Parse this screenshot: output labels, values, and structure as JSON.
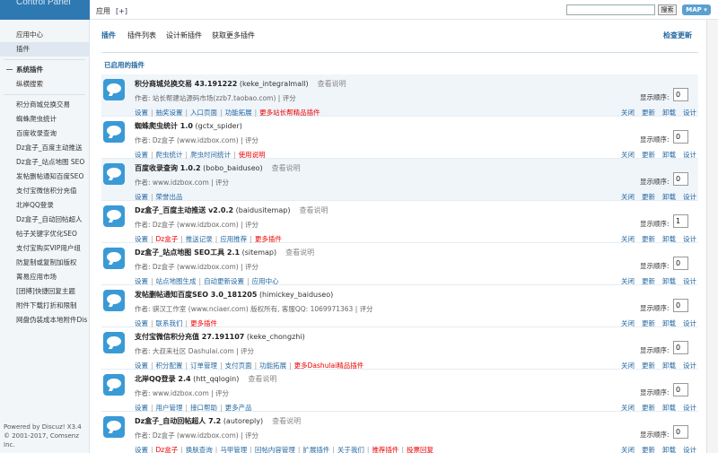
{
  "brand": "Control Panel",
  "header": {
    "crumb": "应用",
    "add": "[+]",
    "search_btn": "搜索",
    "map_btn": "MAP ▾"
  },
  "sidebar": {
    "items": [
      {
        "label": "应用中心",
        "type": "item"
      },
      {
        "label": "插件",
        "type": "item",
        "active": true
      },
      {
        "label": "系统插件",
        "type": "group"
      },
      {
        "label": "纵横搜索",
        "type": "item"
      },
      {
        "label": "积分商城兑换交易",
        "type": "item"
      },
      {
        "label": "蜘蛛爬虫统计",
        "type": "item"
      },
      {
        "label": "百度收录查询",
        "type": "item"
      },
      {
        "label": "Dz盒子_百度主动推送",
        "type": "item"
      },
      {
        "label": "Dz盒子_站点地图 SEO",
        "type": "item"
      },
      {
        "label": "发帖删帖通知百度SEO",
        "type": "item"
      },
      {
        "label": "支付宝微信积分充值",
        "type": "item"
      },
      {
        "label": "北岸QQ登录",
        "type": "item"
      },
      {
        "label": "Dz盒子_自动回帖超人",
        "type": "item"
      },
      {
        "label": "帖子关键字优化SEO",
        "type": "item"
      },
      {
        "label": "支付宝购买VIP用户组",
        "type": "item"
      },
      {
        "label": "防复制或复制加版权",
        "type": "item"
      },
      {
        "label": "菁易应用市场",
        "type": "item"
      },
      {
        "label": "[团搏]快捷回复主题",
        "type": "item"
      },
      {
        "label": "附件下载打折和限制",
        "type": "item"
      },
      {
        "label": "网盘伪装成本地附件Dis",
        "type": "item"
      }
    ],
    "footer_line1": "Powered by Discuz! X3.4",
    "footer_line2": "© 2001-2017, Comsenz Inc."
  },
  "subnav": {
    "current": "插件",
    "tabs": [
      "插件列表",
      "设计新插件",
      "获取更多插件"
    ],
    "check_update": "检查更新"
  },
  "list": {
    "heading": "已启用的插件",
    "order_label": "显示顺序:",
    "ops": [
      "关闭",
      "更新",
      "卸载",
      "设计"
    ],
    "plugins": [
      {
        "name": "积分商城兑换交易 43.191222",
        "id": "(keke_integralmall)",
        "readme": "查看说明",
        "author": "作者: 站长帮建站源码市场(zzb7.taobao.com)",
        "score": "评分",
        "order": "0",
        "shade": true,
        "links": [
          {
            "t": "设置"
          },
          {
            "t": "抽奖设置"
          },
          {
            "t": "入口页面"
          },
          {
            "t": "功能拓展"
          },
          {
            "t": "更多站长帮精品插件",
            "red": true
          }
        ]
      },
      {
        "name": "蜘蛛爬虫统计 1.0",
        "id": "(gctx_spider)",
        "readme": "",
        "author": "作者: Dz盒子 (www.idzbox.com)",
        "score": "评分",
        "order": "0",
        "shade": false,
        "links": [
          {
            "t": "设置"
          },
          {
            "t": "爬虫统计"
          },
          {
            "t": "爬虫时间统计"
          },
          {
            "t": "使用说明",
            "red": true
          }
        ]
      },
      {
        "name": "百度收录查询 1.0.2",
        "id": "(bobo_baiduseo)",
        "readme": "查看说明",
        "author": "作者: www.idzbox.com",
        "score": "评分",
        "order": "0",
        "shade": true,
        "links": [
          {
            "t": "设置"
          },
          {
            "t": "荣誉出品"
          }
        ]
      },
      {
        "name": "Dz盒子_百度主动推送 v2.0.2",
        "id": "(baidusitemap)",
        "readme": "查看说明",
        "author": "作者: Dz盒子 (www.idzbox.com)",
        "score": "评分",
        "order": "1",
        "shade": false,
        "links": [
          {
            "t": "设置"
          },
          {
            "t": "Dz盒子",
            "red": true
          },
          {
            "t": "推送记录"
          },
          {
            "t": "应用推荐"
          },
          {
            "t": "更多插件",
            "red": true
          }
        ]
      },
      {
        "name": "Dz盒子_站点地图 SEO工具 2.1",
        "id": "(sitemap)",
        "readme": "查看说明",
        "author": "作者: Dz盒子 (www.idzbox.com)",
        "score": "评分",
        "order": "0",
        "shade": false,
        "links": [
          {
            "t": "设置"
          },
          {
            "t": "站点地图生成"
          },
          {
            "t": "自动更新设置"
          },
          {
            "t": "应用中心"
          }
        ]
      },
      {
        "name": "发帖删帖通知百度SEO 3.0_181205",
        "id": "(himickey_baiduseo)",
        "readme": "",
        "author": "作者: 骐汉工作室 (www.nciaer.com) 版权所有, 客服QQ: 1069971363",
        "score": "评分",
        "order": "0",
        "shade": false,
        "links": [
          {
            "t": "设置"
          },
          {
            "t": "联系我们"
          },
          {
            "t": "更多插件",
            "red": true
          }
        ]
      },
      {
        "name": "支付宝微信积分充值 27.191107",
        "id": "(keke_chongzhi)",
        "readme": "",
        "author": "作者: 大叔来社区 Dashulai.com",
        "score": "评分",
        "order": "0",
        "shade": false,
        "links": [
          {
            "t": "设置"
          },
          {
            "t": "积分配置"
          },
          {
            "t": "订单管理"
          },
          {
            "t": "支付页面"
          },
          {
            "t": "功能拓展"
          },
          {
            "t": "更多Dashulai精品插件",
            "red": true
          }
        ]
      },
      {
        "name": "北岸QQ登录 2.4",
        "id": "(htt_qqlogin)",
        "readme": "查看说明",
        "author": "作者: www.idzbox.com",
        "score": "评分",
        "order": "0",
        "shade": false,
        "links": [
          {
            "t": "设置"
          },
          {
            "t": "用户管理"
          },
          {
            "t": "接口帮助"
          },
          {
            "t": "更多产品"
          }
        ]
      },
      {
        "name": "Dz盒子_自动回帖超人 7.2",
        "id": "(autoreply)",
        "readme": "查看说明",
        "author": "作者: Dz盒子 (www.idzbox.com)",
        "score": "评分",
        "order": "0",
        "shade": false,
        "links": [
          {
            "t": "设置"
          },
          {
            "t": "Dz盒子",
            "red": true
          },
          {
            "t": "换肤查询"
          },
          {
            "t": "马甲管理"
          },
          {
            "t": "回帖内容管理"
          },
          {
            "t": "扩展插件"
          },
          {
            "t": "关于我们"
          },
          {
            "t": "推荐插件",
            "red": true
          },
          {
            "t": "投票回复",
            "red": true
          }
        ]
      }
    ]
  }
}
